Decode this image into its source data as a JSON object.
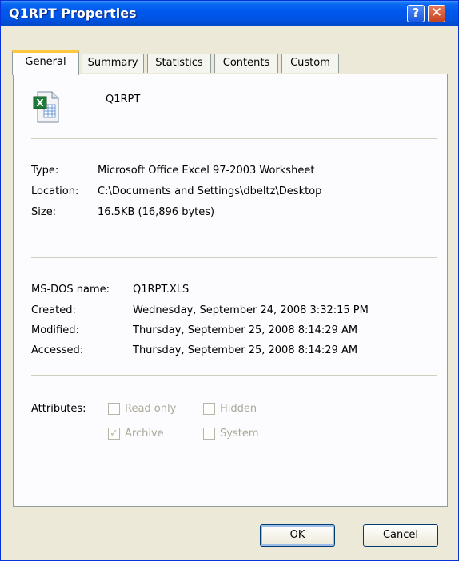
{
  "window": {
    "title": "Q1RPT Properties",
    "help_label": "?",
    "close_label": "✕"
  },
  "tabs": [
    {
      "label": "General",
      "active": true
    },
    {
      "label": "Summary"
    },
    {
      "label": "Statistics"
    },
    {
      "label": "Contents"
    },
    {
      "label": "Custom"
    }
  ],
  "file": {
    "name": "Q1RPT",
    "icon": "excel-file-icon"
  },
  "info": {
    "type_label": "Type:",
    "type_value": "Microsoft Office Excel 97-2003 Worksheet",
    "location_label": "Location:",
    "location_value": "C:\\Documents and Settings\\dbeltz\\Desktop",
    "size_label": "Size:",
    "size_value": "16.5KB (16,896 bytes)"
  },
  "dates": {
    "msdos_label": "MS-DOS name:",
    "msdos_value": "Q1RPT.XLS",
    "created_label": "Created:",
    "created_value": "Wednesday, September 24, 2008 3:32:15 PM",
    "modified_label": "Modified:",
    "modified_value": "Thursday, September 25, 2008 8:14:29 AM",
    "accessed_label": "Accessed:",
    "accessed_value": "Thursday, September 25, 2008 8:14:29 AM"
  },
  "attributes": {
    "label": "Attributes:",
    "read_only": {
      "label": "Read only",
      "checked": false
    },
    "hidden": {
      "label": "Hidden",
      "checked": false
    },
    "archive": {
      "label": "Archive",
      "checked": true
    },
    "system": {
      "label": "System",
      "checked": false
    }
  },
  "buttons": {
    "ok": "OK",
    "cancel": "Cancel"
  },
  "colors": {
    "titlebar": "#0054e3",
    "dialog_bg": "#ece9d8",
    "active_tab_accent": "#ffc83c"
  }
}
